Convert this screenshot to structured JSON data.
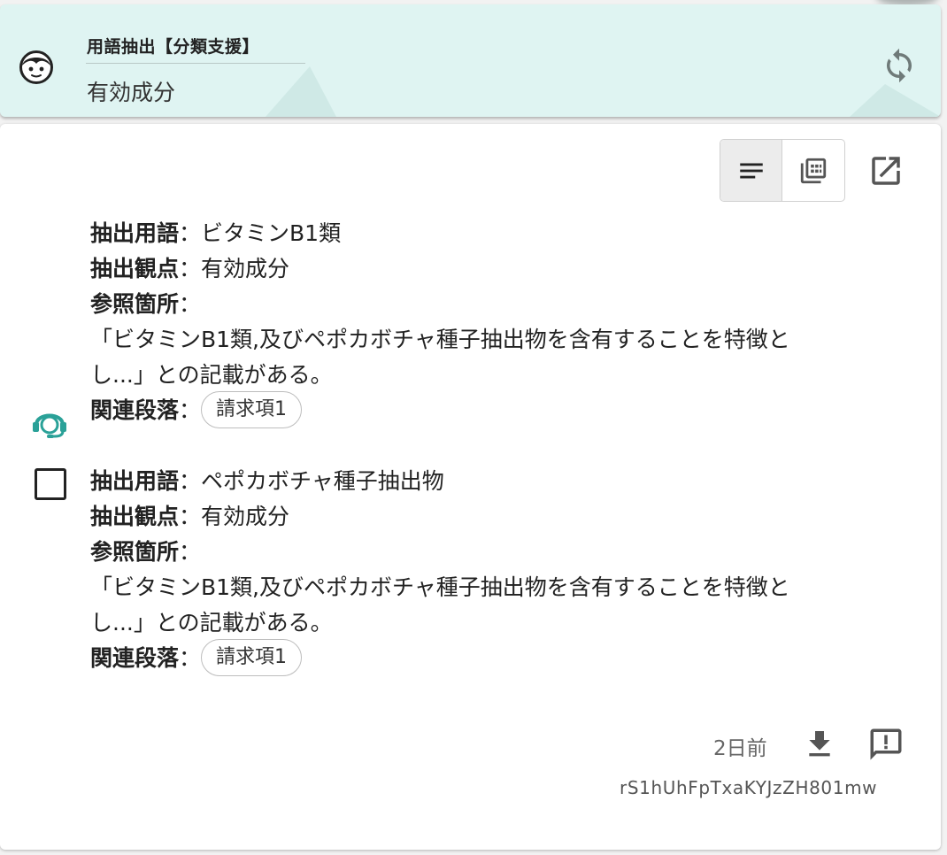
{
  "header": {
    "title": "用語抽出【分類支援】",
    "value": "有効成分",
    "accent": "#dff4f2"
  },
  "toolbar": {
    "view_list_icon": "text-lines-icon",
    "view_table_icon": "library-icon",
    "open_icon": "open-in-new-icon"
  },
  "entries": [
    {
      "term_label": "抽出用語",
      "term": "ビタミンB1類",
      "viewpoint_label": "抽出観点",
      "viewpoint": "有効成分",
      "reference_label": "参照箇所",
      "quote_line1": "「ビタミンB1類,及びペポカボチャ種子抽出物を含有することを特徴と",
      "quote_line2": "し...」との記載がある。",
      "paragraph_label": "関連段落",
      "paragraph_chip": "請求項1"
    },
    {
      "term_label": "抽出用語",
      "term": "ペポカボチャ種子抽出物",
      "viewpoint_label": "抽出観点",
      "viewpoint": "有効成分",
      "reference_label": "参照箇所",
      "quote_line1": "「ビタミンB1類,及びペポカボチャ種子抽出物を含有することを特徴と",
      "quote_line2": "し...」との記載がある。",
      "paragraph_label": "関連段落",
      "paragraph_chip": "請求項1"
    }
  ],
  "separator": "：",
  "footer": {
    "time": "2日前",
    "id": "rS1hUhFpTxaKYJzZH801mw"
  },
  "colors": {
    "teal": "#2aa198"
  }
}
